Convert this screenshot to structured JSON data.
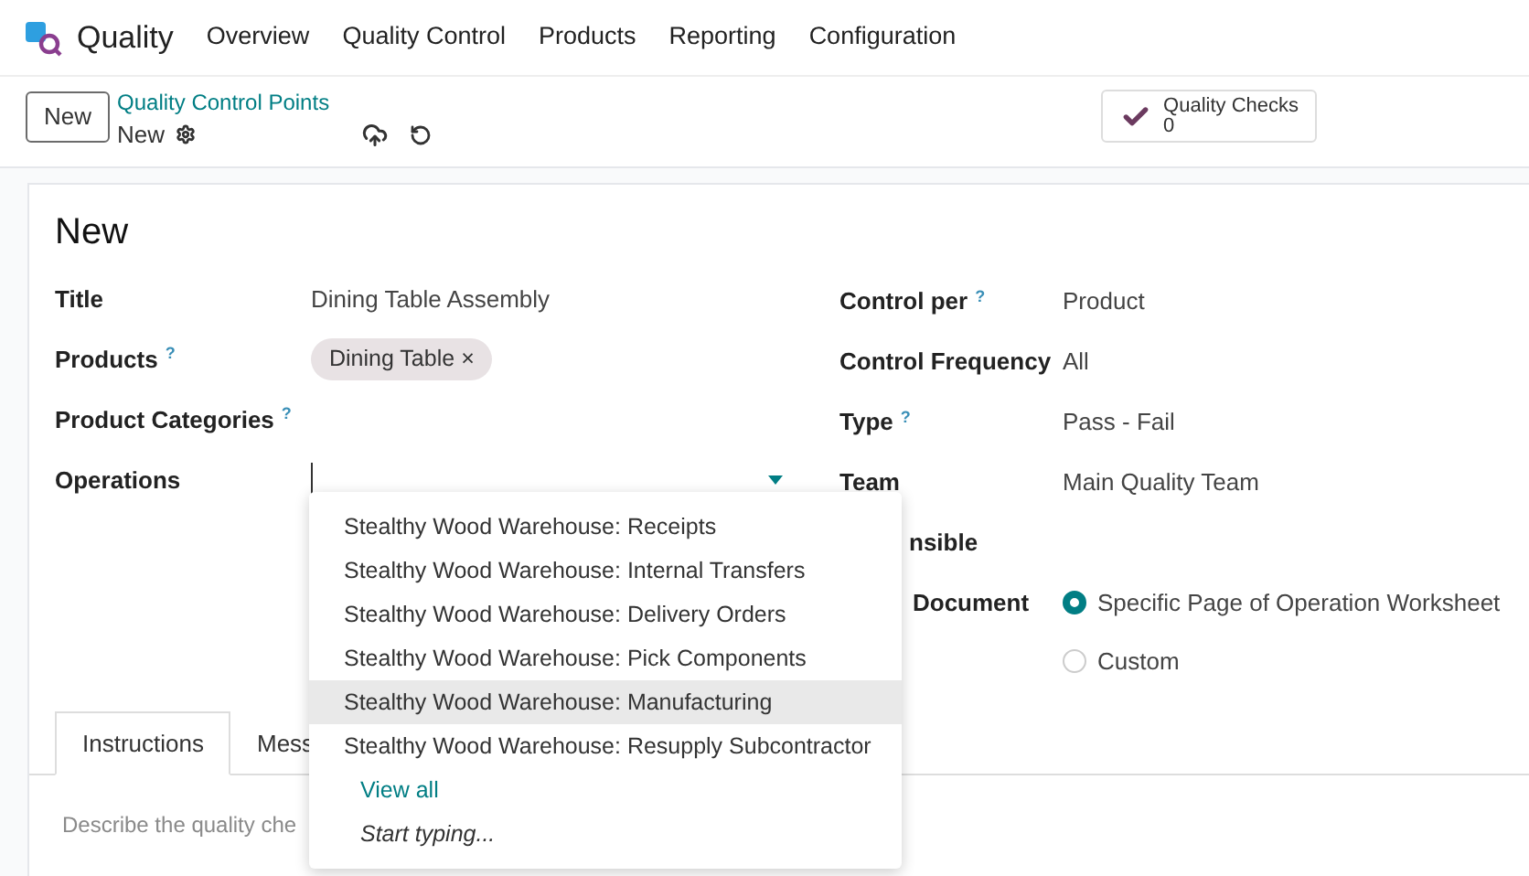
{
  "navbar": {
    "app_name": "Quality",
    "menu": [
      "Overview",
      "Quality Control",
      "Products",
      "Reporting",
      "Configuration"
    ]
  },
  "control_panel": {
    "new_button": "New",
    "breadcrumb": "Quality Control Points",
    "record_name": "New",
    "smart_button": {
      "label": "Quality Checks",
      "count": "0"
    }
  },
  "form": {
    "title": "New",
    "left_fields": [
      {
        "kind": "text",
        "label": "Title",
        "value": "Dining Table Assembly"
      },
      {
        "kind": "tags",
        "label": "Products",
        "help": "?",
        "tags": [
          {
            "label": "Dining Table",
            "remove": "×"
          }
        ]
      },
      {
        "kind": "text",
        "label": "Product Categories",
        "help": "?"
      },
      {
        "kind": "select",
        "label": "Operations"
      }
    ],
    "right_fields": [
      {
        "kind": "text",
        "label": "Control per",
        "help": "?",
        "value": "Product"
      },
      {
        "kind": "text",
        "label": "Control Frequency",
        "value": "All"
      },
      {
        "kind": "text",
        "label": "Type",
        "help": "?",
        "value": "Pass - Fail"
      },
      {
        "kind": "text",
        "label": "Team",
        "value": "Main Quality Team"
      },
      {
        "kind": "covered",
        "label": "nsible"
      },
      {
        "kind": "radio",
        "label": "Document",
        "options": [
          {
            "label": "Specific Page of Operation Worksheet",
            "selected": true
          },
          {
            "label": "Custom",
            "selected": false
          }
        ]
      }
    ],
    "tabs": [
      {
        "label": "Instructions",
        "selected": true
      },
      {
        "label": "Mess",
        "selected": false
      }
    ],
    "placeholder": "Describe the quality che"
  },
  "dropdown": {
    "items": [
      {
        "label": "Stealthy Wood Warehouse: Receipts",
        "selected": false
      },
      {
        "label": "Stealthy Wood Warehouse: Internal Transfers",
        "selected": false
      },
      {
        "label": "Stealthy Wood Warehouse: Delivery Orders",
        "selected": false
      },
      {
        "label": "Stealthy Wood Warehouse: Pick Components",
        "selected": false
      },
      {
        "label": "Stealthy Wood Warehouse: Manufacturing",
        "selected": true
      },
      {
        "label": "Stealthy Wood Warehouse: Resupply Subcontractor",
        "selected": false
      }
    ],
    "view_all": "View all",
    "start_typing": "Start typing..."
  }
}
